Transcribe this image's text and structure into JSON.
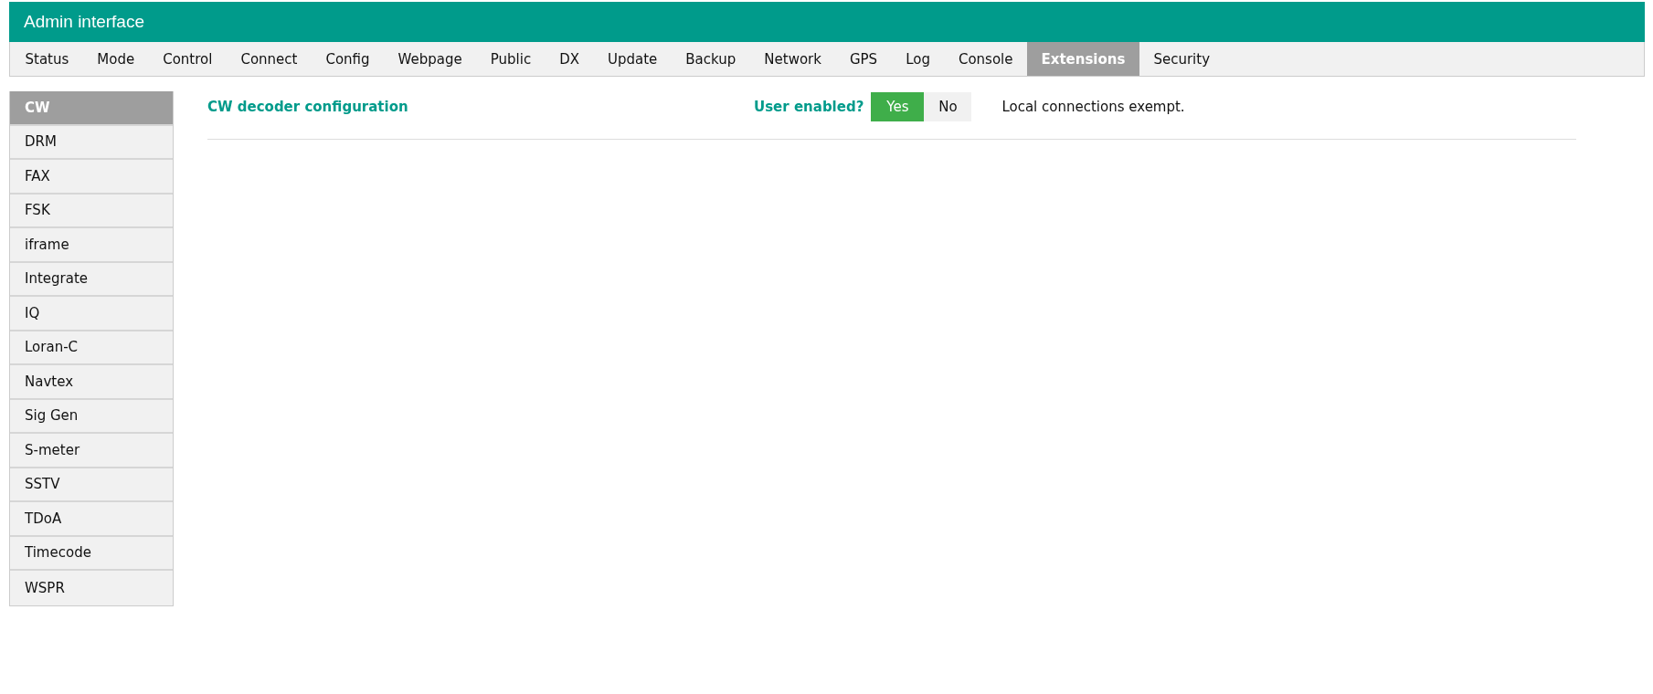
{
  "header": {
    "title": "Admin interface"
  },
  "tabs": [
    {
      "label": "Status",
      "selected": false
    },
    {
      "label": "Mode",
      "selected": false
    },
    {
      "label": "Control",
      "selected": false
    },
    {
      "label": "Connect",
      "selected": false
    },
    {
      "label": "Config",
      "selected": false
    },
    {
      "label": "Webpage",
      "selected": false
    },
    {
      "label": "Public",
      "selected": false
    },
    {
      "label": "DX",
      "selected": false
    },
    {
      "label": "Update",
      "selected": false
    },
    {
      "label": "Backup",
      "selected": false
    },
    {
      "label": "Network",
      "selected": false
    },
    {
      "label": "GPS",
      "selected": false
    },
    {
      "label": "Log",
      "selected": false
    },
    {
      "label": "Console",
      "selected": false
    },
    {
      "label": "Extensions",
      "selected": true
    },
    {
      "label": "Security",
      "selected": false
    }
  ],
  "sidebar": {
    "items": [
      {
        "label": "CW",
        "selected": true
      },
      {
        "label": "DRM",
        "selected": false
      },
      {
        "label": "FAX",
        "selected": false
      },
      {
        "label": "FSK",
        "selected": false
      },
      {
        "label": "iframe",
        "selected": false
      },
      {
        "label": "Integrate",
        "selected": false
      },
      {
        "label": "IQ",
        "selected": false
      },
      {
        "label": "Loran-C",
        "selected": false
      },
      {
        "label": "Navtex",
        "selected": false
      },
      {
        "label": "Sig Gen",
        "selected": false
      },
      {
        "label": "S-meter",
        "selected": false
      },
      {
        "label": "SSTV",
        "selected": false
      },
      {
        "label": "TDoA",
        "selected": false
      },
      {
        "label": "Timecode",
        "selected": false
      },
      {
        "label": "WSPR",
        "selected": false
      }
    ]
  },
  "content": {
    "title": "CW decoder configuration",
    "toggle_label": "User enabled?",
    "toggle_options": [
      {
        "label": "Yes",
        "selected": true
      },
      {
        "label": "No",
        "selected": false
      }
    ],
    "note": "Local connections exempt."
  }
}
